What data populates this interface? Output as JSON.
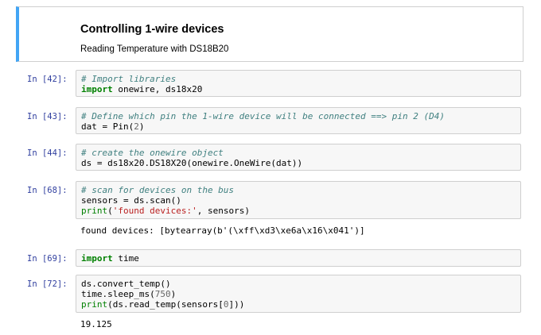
{
  "markdown": {
    "title": "Controlling 1-wire devices",
    "subtitle": "Reading Temperature with DS18B20"
  },
  "cells": [
    {
      "prompt": "In [42]:",
      "lines": [
        [
          {
            "t": "# Import libraries",
            "c": "c"
          }
        ],
        [
          {
            "t": "import",
            "c": "k"
          },
          {
            "t": " onewire, ds18x20",
            "c": ""
          }
        ]
      ]
    },
    {
      "prompt": "In [43]:",
      "lines": [
        [
          {
            "t": "# Define which pin the 1-wire device will be connected ==> pin 2 (D4)",
            "c": "c"
          }
        ],
        [
          {
            "t": "dat = Pin(",
            "c": ""
          },
          {
            "t": "2",
            "c": "num"
          },
          {
            "t": ")",
            "c": ""
          }
        ]
      ]
    },
    {
      "prompt": "In [44]:",
      "lines": [
        [
          {
            "t": "# create the onewire object",
            "c": "c"
          }
        ],
        [
          {
            "t": "ds = ds18x20.DS18X20(onewire.OneWire(dat))",
            "c": ""
          }
        ]
      ]
    },
    {
      "prompt": "In [68]:",
      "lines": [
        [
          {
            "t": "# scan for devices on the bus",
            "c": "c"
          }
        ],
        [
          {
            "t": "sensors = ds.scan()",
            "c": ""
          }
        ],
        [
          {
            "t": "print",
            "c": "n"
          },
          {
            "t": "(",
            "c": ""
          },
          {
            "t": "'found devices:'",
            "c": "s"
          },
          {
            "t": ", sensors)",
            "c": ""
          }
        ]
      ],
      "output": "found devices: [bytearray(b'(\\xff\\xd3\\xe6a\\x16\\x041')]"
    },
    {
      "prompt": "In [69]:",
      "lines": [
        [
          {
            "t": "import",
            "c": "k"
          },
          {
            "t": " time",
            "c": ""
          }
        ]
      ]
    },
    {
      "prompt": "In [72]:",
      "lines": [
        [
          {
            "t": "ds.convert_temp()",
            "c": ""
          }
        ],
        [
          {
            "t": "time.sleep_ms(",
            "c": ""
          },
          {
            "t": "750",
            "c": "num"
          },
          {
            "t": ")",
            "c": ""
          }
        ],
        [
          {
            "t": "print",
            "c": "n"
          },
          {
            "t": "(ds.read_temp(sensors[",
            "c": ""
          },
          {
            "t": "0",
            "c": "num"
          },
          {
            "t": "]))",
            "c": ""
          }
        ]
      ],
      "output": "19.125"
    }
  ]
}
